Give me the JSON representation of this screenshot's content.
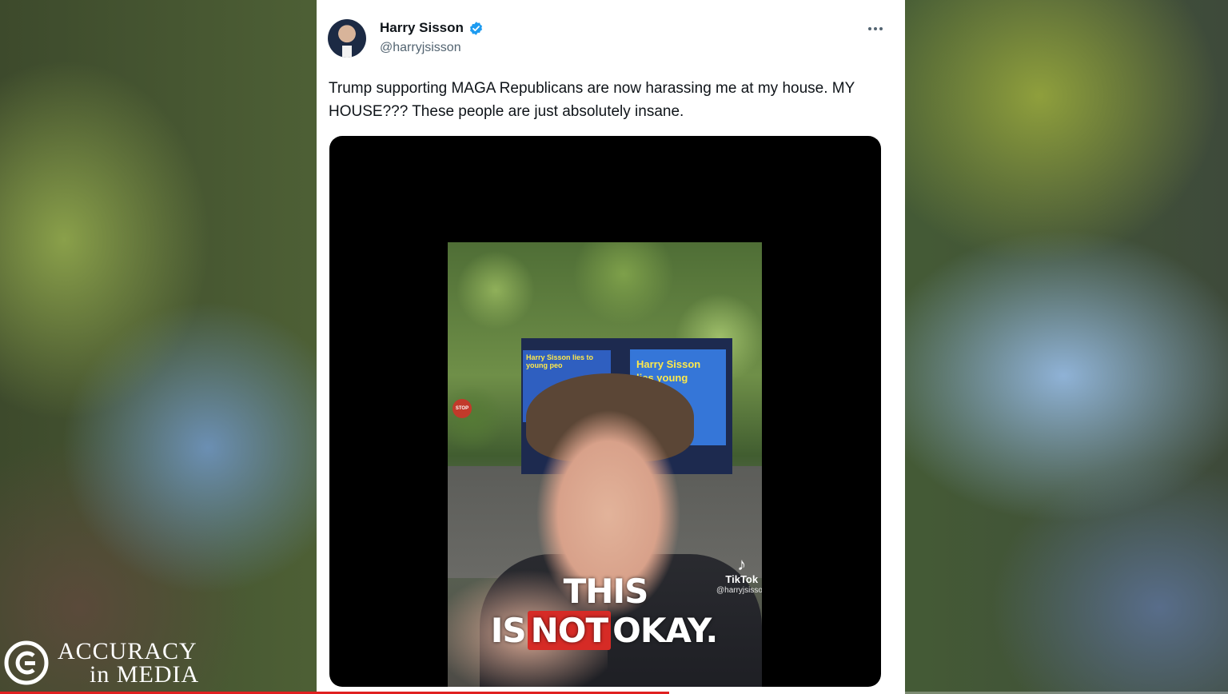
{
  "tweet": {
    "display_name": "Harry Sisson",
    "handle": "@harryjsisson",
    "verified_icon": "verified-badge-icon",
    "more_icon": "more-options-icon",
    "text": "Trump supporting MAGA Republicans are now harassing me at my house. MY HOUSE??? These people are just absolutely insane."
  },
  "video": {
    "billboard_left_text": "Harry Sisson lies to young peo",
    "billboard_right_text": "Harry Sisson lies young people.",
    "stop_sign_text": "STOP",
    "caption_words": [
      "THIS IS",
      "NOT",
      "OKAY."
    ],
    "tiktok_label": "TikTok",
    "tiktok_handle": "@harryjsisson"
  },
  "brand": {
    "line1": "ACCURACY",
    "line2": "in MEDIA"
  },
  "progress": {
    "fraction": 0.545,
    "color": "#e02020"
  }
}
